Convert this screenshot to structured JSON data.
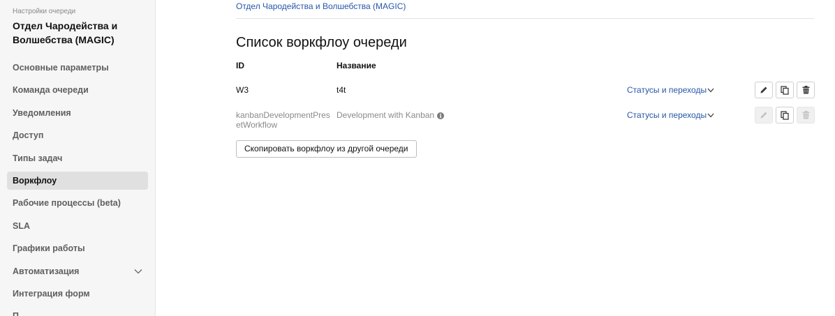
{
  "sidebar": {
    "caption": "Настройки очереди",
    "title": "Отдел Чародейства и Волшебства (MAGIC)",
    "items": [
      {
        "label": "Основные параметры"
      },
      {
        "label": "Команда очереди"
      },
      {
        "label": "Уведомления"
      },
      {
        "label": "Доступ"
      },
      {
        "label": "Типы задач"
      },
      {
        "label": "Воркфлоу",
        "active": true
      },
      {
        "label": "Рабочие процессы (beta)"
      },
      {
        "label": "SLA"
      },
      {
        "label": "Графики работы"
      },
      {
        "label": "Автоматизация",
        "icon": "chevron-down-icon"
      },
      {
        "label": "Интеграция форм"
      },
      {
        "label": "П..."
      }
    ]
  },
  "main": {
    "breadcrumb": "Отдел Чародейства и Волшебства (MAGIC)",
    "heading": "Список воркфлоу очереди",
    "columns": {
      "id": "ID",
      "name": "Название"
    },
    "rows": [
      {
        "id": "W3",
        "name": "t4t",
        "statuses_link": "Статусы и переходы",
        "actions": {
          "edit": "enabled",
          "copy": "enabled",
          "delete": "enabled"
        }
      },
      {
        "id": "kanbanDevelopmentPresetWorkflow",
        "name": "Development with Kanban",
        "name_icon": "info-icon",
        "statuses_link": "Статусы и переходы",
        "actions": {
          "edit": "disabled",
          "copy": "enabled",
          "delete": "disabled"
        }
      }
    ],
    "copy_button": "Скопировать воркфлоу из другой очереди"
  },
  "colors": {
    "link": "#2856a8",
    "sidebar_bg": "#f6f6f6",
    "active_item_bg": "#e0e0e0",
    "muted_text": "#8a8a8a"
  }
}
